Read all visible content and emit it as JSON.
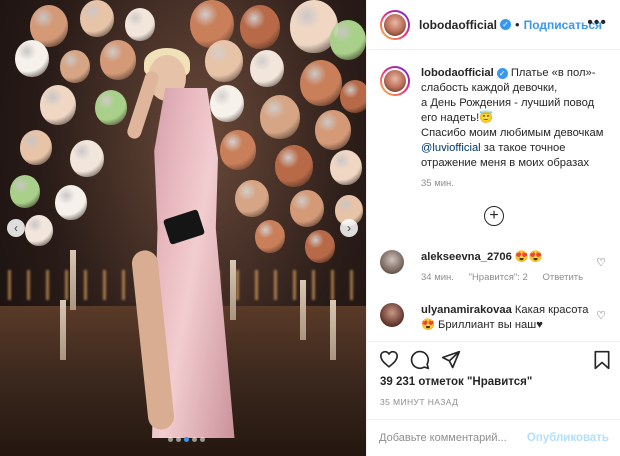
{
  "post": {
    "username": "lobodaofficial",
    "follow_label": "Подписаться",
    "separator": "•",
    "more_label": "•••"
  },
  "caption": {
    "username": "lobodaofficial",
    "line1": " Платье «в пол»-",
    "line2": "слабость каждой девочки,",
    "line3": "а День Рождения - лучший повод",
    "line4": "его надеть!😇",
    "line5": "Спасибо моим любимым девочкам",
    "mention": "@luviofficial",
    "line6": " за такое точное",
    "line7": "отражение меня в моих образах",
    "time": "35 мин."
  },
  "comments": [
    {
      "username": "alekseevna_2706",
      "text": " 😍😍",
      "time": "34 мин.",
      "likes": "\"Нравится\": 2",
      "reply": "Ответить"
    },
    {
      "username": "ulyanamirakovaa",
      "text": " Какая красота",
      "text2": "😍 Бриллиант вы наш♥",
      "time": "",
      "likes": "",
      "reply": ""
    }
  ],
  "likes_text": "39 231 отметок \"Нравится\"",
  "posted_ago": "35 МИНУТ НАЗАД",
  "comment_input": {
    "placeholder": "Добавьте комментарий...",
    "value": ""
  },
  "publish_label": "Опубликовать",
  "load_more_symbol": "+",
  "nav": {
    "prev": "‹",
    "next": "›"
  },
  "icons": [
    "heart-icon",
    "comment-icon",
    "share-icon",
    "bookmark-icon",
    "verified-icon"
  ],
  "colors": {
    "accent": "#3897f0",
    "text": "#262626",
    "muted": "#8e8e8e",
    "publish_disabled": "#b2dffc"
  }
}
